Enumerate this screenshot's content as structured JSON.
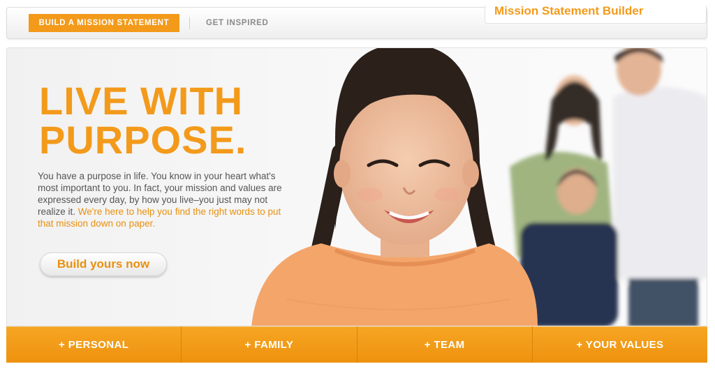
{
  "nav": {
    "build_label": "BUILD A MISSION STATEMENT",
    "inspired_label": "GET INSPIRED",
    "brand_title": "Mission Statement Builder"
  },
  "hero": {
    "headline_line1": "LIVE WITH",
    "headline_line2": "PURPOSE.",
    "body_plain": "You have a purpose in life. You know in your heart what's most important to you. In fact, your mission and values are expressed every day, by how you live–you just may not realize it. ",
    "body_highlight": "We're here to help you find the right words to put that mission down on paper.",
    "cta_label": "Build yours now"
  },
  "tabs": [
    {
      "label": "+ PERSONAL"
    },
    {
      "label": "+ FAMILY"
    },
    {
      "label": "+ TEAM"
    },
    {
      "label": "+ YOUR VALUES"
    }
  ],
  "colors": {
    "accent": "#f39a1b",
    "text": "#555555",
    "tab_bg": "#f6a623"
  }
}
